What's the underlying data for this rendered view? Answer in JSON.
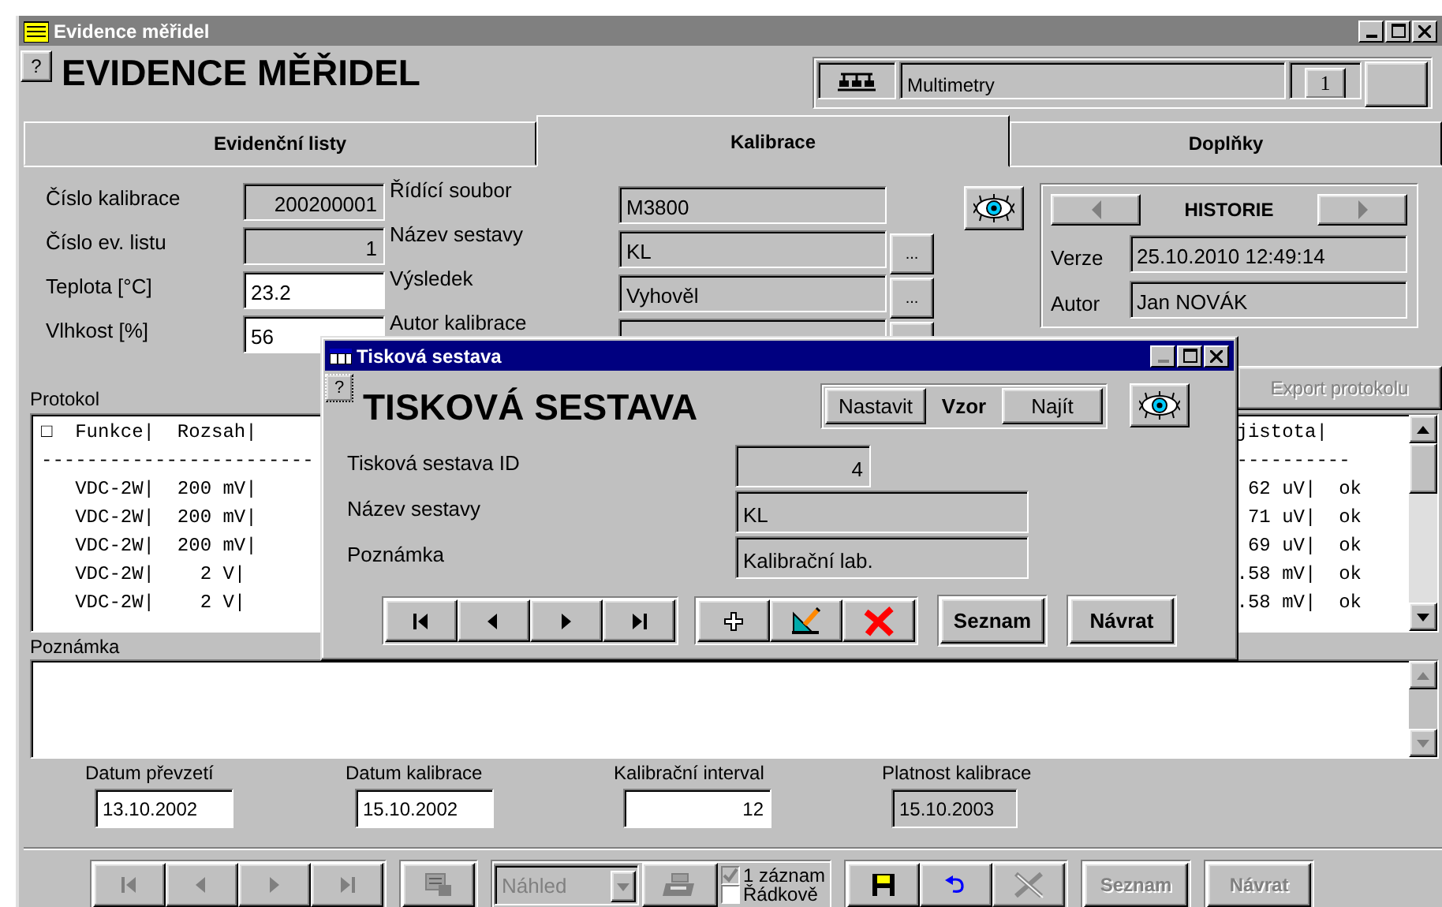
{
  "window": {
    "title": "Evidence měřidel"
  },
  "header": {
    "help": "?",
    "title": "EVIDENCE MĚŘIDEL",
    "category": "Multimetry",
    "counter": "1"
  },
  "tabs": [
    {
      "label": "Evidenční listy",
      "selected": false
    },
    {
      "label": "Kalibrace",
      "selected": true
    },
    {
      "label": "Doplňky",
      "selected": false
    }
  ],
  "fields_left": [
    {
      "label": "Číslo kalibrace",
      "value": "200200001",
      "editable": false,
      "numeric": true
    },
    {
      "label": "Číslo ev. listu",
      "value": "1",
      "editable": false,
      "numeric": true
    },
    {
      "label": "Teplota  [°C]",
      "value": "23.2",
      "editable": true,
      "numeric": false
    },
    {
      "label": "Vlhkost  [%]",
      "value": "56",
      "editable": true,
      "numeric": false
    }
  ],
  "fields_middle": [
    {
      "label": "Řídící soubor",
      "value": "M3800",
      "picker": false
    },
    {
      "label": "Název sestavy",
      "value": "KL",
      "picker": true,
      "picker_label": "..."
    },
    {
      "label": "Výsledek",
      "value": "Vyhověl",
      "picker": true,
      "picker_label": "..."
    },
    {
      "label": "Autor kalibrace",
      "picker": true
    }
  ],
  "history": {
    "title": "HISTORIE",
    "version_label": "Verze",
    "version": "25.10.2010 12:49:14",
    "author_label": "Autor",
    "author": "Jan NOVÁK"
  },
  "export_button": {
    "label": "Export protokolu",
    "disabled": true
  },
  "protocol": {
    "label": "Protokol",
    "lines_left": [
      "□  Funkce|  Rozsah|",
      "------------------------",
      "   VDC-2W|  200 mV|",
      "   VDC-2W|  200 mV|",
      "   VDC-2W|  200 mV|",
      "   VDC-2W|    2 V|",
      "   VDC-2W|    2 V|"
    ],
    "lines_right": [
      "jistota|",
      "----------",
      " 62 uV|  ok",
      " 71 uV|  ok",
      " 69 uV|  ok",
      ".58 mV|  ok",
      ".58 mV|  ok"
    ]
  },
  "note": {
    "label": "Poznámka"
  },
  "dates": [
    {
      "label": "Datum převzetí",
      "value": "13.10.2002",
      "editable": true,
      "numeric": false
    },
    {
      "label": "Datum kalibrace",
      "value": "15.10.2002",
      "editable": true,
      "numeric": false
    },
    {
      "label": "Kalibrační interval",
      "value": "12",
      "editable": true,
      "numeric": true
    },
    {
      "label": "Platnost kalibrace",
      "value": "15.10.2003",
      "editable": false,
      "numeric": false
    }
  ],
  "toolbar": {
    "nav_buttons": [
      {
        "kind": "first",
        "disabled": true
      },
      {
        "kind": "prev",
        "disabled": true
      },
      {
        "kind": "next",
        "disabled": true
      },
      {
        "kind": "last",
        "disabled": true
      }
    ],
    "report_button": {
      "disabled": true
    },
    "preview": {
      "value": "Náhled",
      "disabled": true
    },
    "print_button": {
      "disabled": true
    },
    "options": [
      {
        "label": "1 záznam",
        "checked": true,
        "disabled": true
      },
      {
        "label": "Řádkově",
        "checked": false,
        "disabled": false
      }
    ],
    "edit_buttons": [
      {
        "kind": "save",
        "disabled": false
      },
      {
        "kind": "undo",
        "disabled": false
      },
      {
        "kind": "delete",
        "disabled": true
      }
    ],
    "buttons": [
      {
        "label": "Seznam",
        "disabled": true
      },
      {
        "label": "Návrat",
        "disabled": true
      }
    ]
  },
  "dialog": {
    "title": "Tisková sestava",
    "help": "?",
    "heading": "TISKOVÁ SESTAVA",
    "search": {
      "set": "Nastavit",
      "label": "Vzor",
      "find": "Najít"
    },
    "fields": [
      {
        "label": "Tisková sestava ID",
        "value": "4",
        "numeric": true
      },
      {
        "label": "Název sestavy",
        "value": "KL",
        "numeric": false
      },
      {
        "label": "Poznámka",
        "value": "Kalibrační lab.",
        "numeric": false
      }
    ],
    "nav_buttons": [
      {
        "kind": "first",
        "disabled": false
      },
      {
        "kind": "prev",
        "disabled": false
      },
      {
        "kind": "next",
        "disabled": false
      },
      {
        "kind": "last",
        "disabled": false
      }
    ],
    "edit_buttons": [
      {
        "kind": "add",
        "disabled": false
      },
      {
        "kind": "edit",
        "disabled": false
      },
      {
        "kind": "delete",
        "disabled": false
      }
    ],
    "buttons": [
      {
        "label": "Seznam",
        "disabled": false
      },
      {
        "label": "Návrat",
        "disabled": false
      }
    ]
  }
}
